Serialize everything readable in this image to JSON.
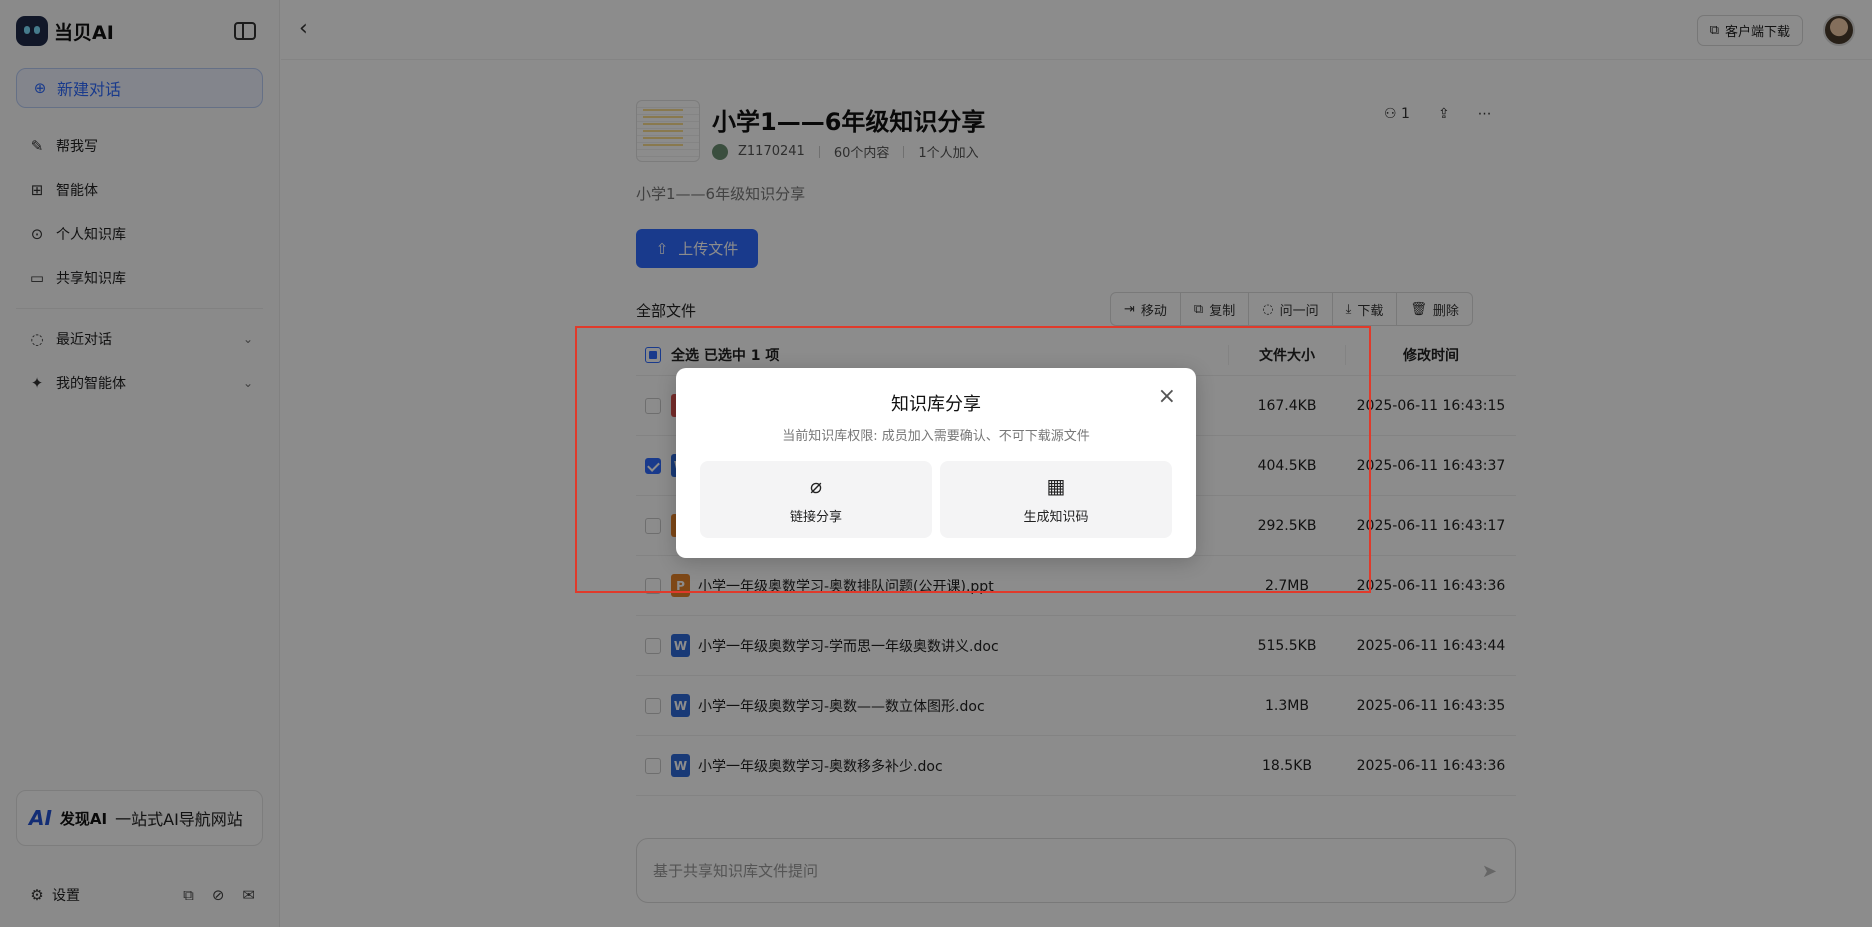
{
  "app": {
    "name": "当贝AI"
  },
  "sidebar": {
    "new_chat": "新建对话",
    "items": [
      {
        "label": "帮我写",
        "icon": "pen-icon"
      },
      {
        "label": "智能体",
        "icon": "apps-icon"
      },
      {
        "label": "个人知识库",
        "icon": "upload-circle-icon"
      },
      {
        "label": "共享知识库",
        "icon": "shared-folder-icon"
      }
    ],
    "sections": [
      {
        "label": "最近对话",
        "icon": "chat-icon"
      },
      {
        "label": "我的智能体",
        "icon": "sparkle-icon"
      }
    ],
    "promo": {
      "logo": "AI",
      "brand": "发现AI",
      "text": "一站式AI导航网站"
    },
    "settings": "设置"
  },
  "topbar": {
    "download_client": "客户端下载"
  },
  "kb": {
    "title": "小学1——6年级知识分享",
    "owner": "Z1170241",
    "content_count": "60个内容",
    "members_joined": "1个人加入",
    "member_count": "1",
    "description": "小学1——6年级知识分享",
    "upload": "上传文件"
  },
  "files": {
    "label": "全部文件",
    "toolbar": [
      "移动",
      "复制",
      "问一问",
      "下载",
      "删除"
    ],
    "select_all": "全选",
    "selected_text": "已选中 1 项",
    "col_size": "文件大小",
    "col_date": "修改时间",
    "rows": [
      {
        "name": "",
        "type": "pdf",
        "size": "167.4KB",
        "date": "2025-06-11 16:43:15",
        "checked": false
      },
      {
        "name": "",
        "type": "w",
        "size": "404.5KB",
        "date": "2025-06-11 16:43:37",
        "checked": true
      },
      {
        "name": "",
        "type": "p",
        "size": "292.5KB",
        "date": "2025-06-11 16:43:17",
        "checked": false
      },
      {
        "name": "小学一年级奥数学习-奥数排队问题(公开课).ppt",
        "type": "p",
        "size": "2.7MB",
        "date": "2025-06-11 16:43:36",
        "checked": false
      },
      {
        "name": "小学一年级奥数学习-学而思一年级奥数讲义.doc",
        "type": "w",
        "size": "515.5KB",
        "date": "2025-06-11 16:43:44",
        "checked": false
      },
      {
        "name": "小学一年级奥数学习-奥数——数立体图形.doc",
        "type": "w",
        "size": "1.3MB",
        "date": "2025-06-11 16:43:35",
        "checked": false
      },
      {
        "name": "小学一年级奥数学习-奥数移多补少.doc",
        "type": "w",
        "size": "18.5KB",
        "date": "2025-06-11 16:43:36",
        "checked": false
      }
    ]
  },
  "ask": {
    "placeholder": "基于共享知识库文件提问"
  },
  "modal": {
    "title": "知识库分享",
    "subtitle": "当前知识库权限: 成员加入需要确认、不可下载源文件",
    "options": [
      {
        "label": "链接分享",
        "icon": "paperclip-icon"
      },
      {
        "label": "生成知识码",
        "icon": "qr-code-icon"
      }
    ]
  },
  "colors": {
    "accent": "#2f6bff",
    "highlight": "#e03a2b"
  }
}
